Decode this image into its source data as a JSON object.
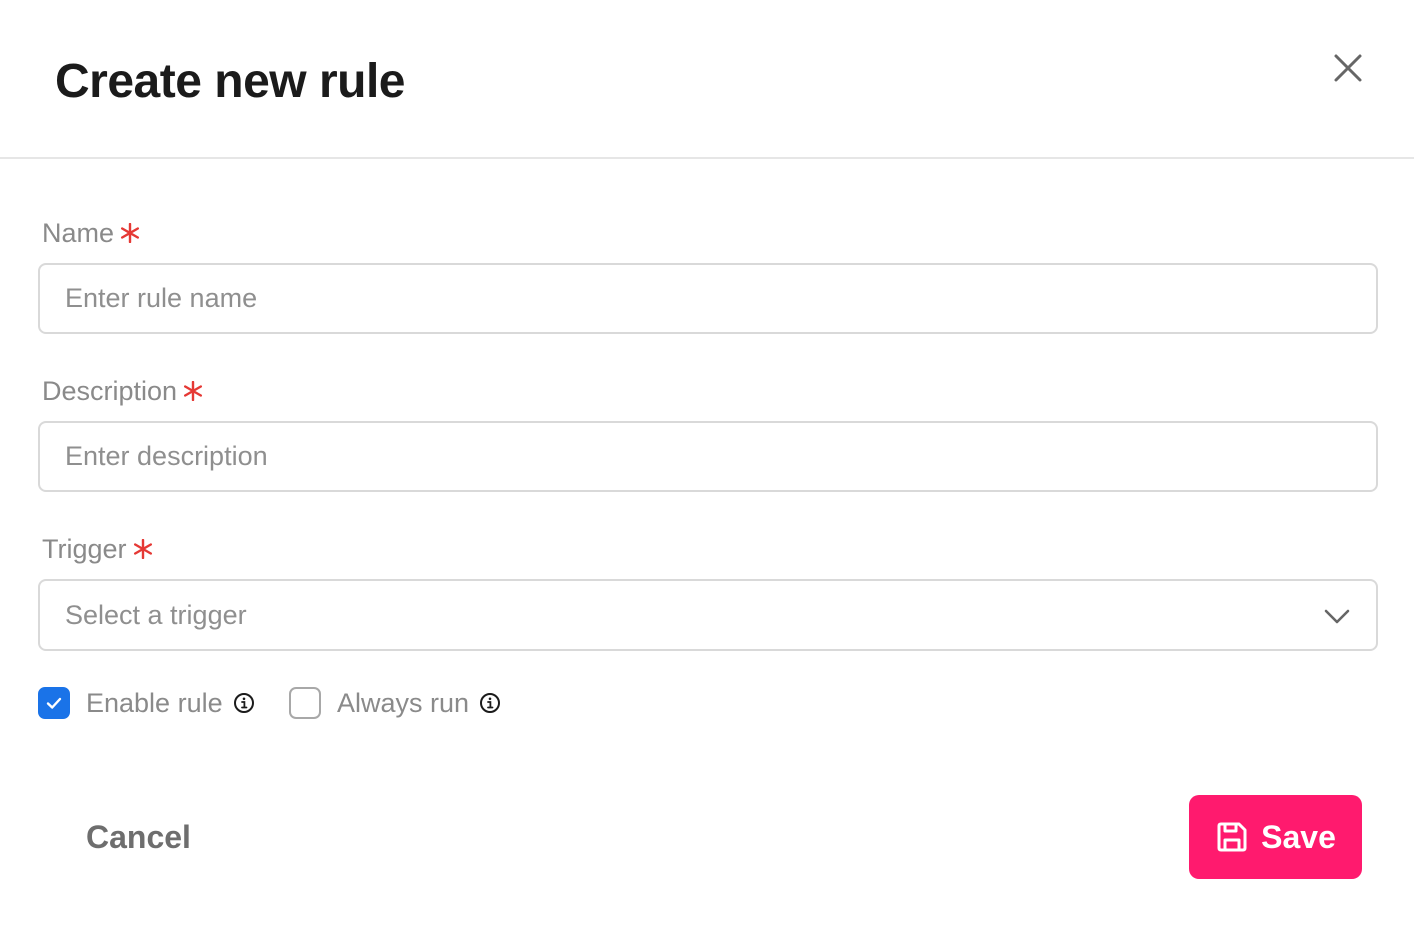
{
  "dialog": {
    "title": "Create new rule"
  },
  "form": {
    "name": {
      "label": "Name",
      "placeholder": "Enter rule name",
      "value": ""
    },
    "description": {
      "label": "Description",
      "placeholder": "Enter description",
      "value": ""
    },
    "trigger": {
      "label": "Trigger",
      "selected": "Select a trigger"
    },
    "options": {
      "enable_rule": {
        "label": "Enable rule",
        "checked": true
      },
      "always_run": {
        "label": "Always run",
        "checked": false
      }
    }
  },
  "actions": {
    "cancel_label": "Cancel",
    "save_label": "Save"
  },
  "colors": {
    "accent": "#ff1a6e",
    "checkbox": "#1a73e8",
    "required": "#e53935",
    "title": "#1b1b1b",
    "label": "#8a8a8a"
  },
  "icons": {
    "close": "close-icon",
    "required": "asterisk-icon",
    "dropdown": "chevron-down-icon",
    "check": "check-icon",
    "info": "info-icon",
    "save": "floppy-disk-icon"
  }
}
